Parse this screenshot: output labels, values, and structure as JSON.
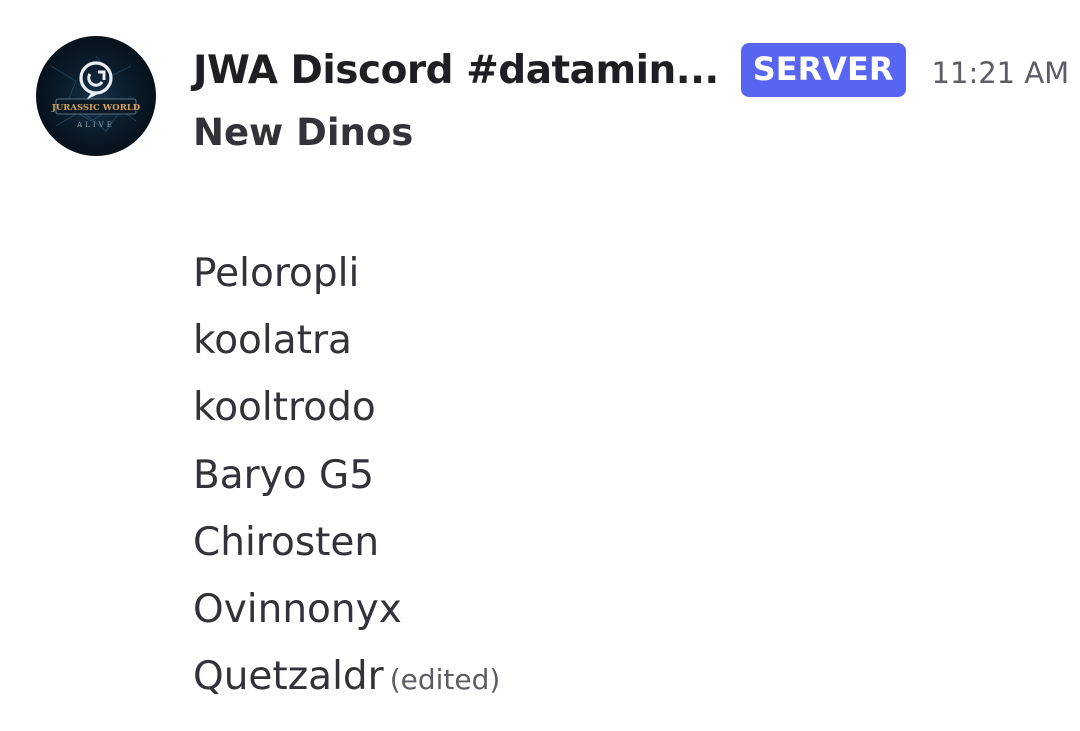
{
  "message": {
    "author": "JWA Discord #datamin...",
    "badge": "SERVER",
    "timestamp": "11:21 AM",
    "subject": "New Dinos",
    "lines": [
      "Peloropli",
      "koolatra",
      "kooltrodo",
      "Baryo G5",
      "Chirosten",
      "Ovinnonyx",
      "Quetzaldr"
    ],
    "edited_label": "(edited)",
    "avatar": {
      "icon": "jurassic-world-alive-logo",
      "wordmark": "JURASSIC WORLD",
      "subtext": "ALIVE"
    }
  },
  "colors": {
    "badge_background": "#5865f2",
    "badge_text": "#ffffff",
    "author_text": "#1e1f22",
    "body_text": "#313338",
    "muted_text": "#5c5e66",
    "background": "#ffffff"
  }
}
